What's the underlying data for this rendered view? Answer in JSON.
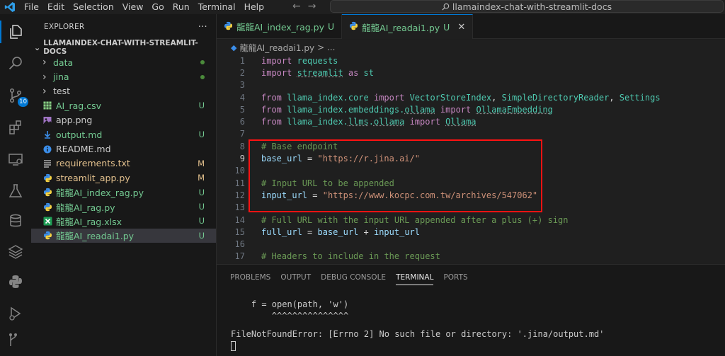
{
  "titlebar": {
    "menu": [
      "File",
      "Edit",
      "Selection",
      "View",
      "Go",
      "Run",
      "Terminal",
      "Help"
    ],
    "search": "llamaindex-chat-with-streamlit-docs"
  },
  "activity": {
    "scm_badge": "10"
  },
  "explorer": {
    "title": "EXPLORER",
    "more": "···",
    "folder": "LLAMAINDEX-CHAT-WITH-STREAMLIT-DOCS",
    "items": [
      {
        "label": "data",
        "kind": "folder",
        "status": "",
        "dot": true,
        "color": "#73c991"
      },
      {
        "label": "jina",
        "kind": "folder",
        "status": "",
        "dot": true,
        "color": "#73c991"
      },
      {
        "label": "test",
        "kind": "folder",
        "status": "",
        "dot": false,
        "color": "#cccccc"
      },
      {
        "label": "AI_rag.csv",
        "kind": "csv",
        "status": "U",
        "dot": false,
        "color": "#73c991"
      },
      {
        "label": "app.png",
        "kind": "image",
        "status": "",
        "dot": false,
        "color": "#cccccc"
      },
      {
        "label": "output.md",
        "kind": "md-download",
        "status": "U",
        "dot": false,
        "color": "#73c991"
      },
      {
        "label": "README.md",
        "kind": "md",
        "status": "",
        "dot": false,
        "color": "#cccccc"
      },
      {
        "label": "requirements.txt",
        "kind": "txt",
        "status": "M",
        "dot": false,
        "color": "#e2c08d"
      },
      {
        "label": "streamlit_app.py",
        "kind": "py",
        "status": "M",
        "dot": false,
        "color": "#e2c08d"
      },
      {
        "label": "龍龍AI_index_rag.py",
        "kind": "py",
        "status": "U",
        "dot": false,
        "color": "#73c991"
      },
      {
        "label": "龍龍AI_rag.py",
        "kind": "py",
        "status": "U",
        "dot": false,
        "color": "#73c991"
      },
      {
        "label": "龍龍AI_rag.xlsx",
        "kind": "xlsx",
        "status": "U",
        "dot": false,
        "color": "#73c991"
      },
      {
        "label": "龍龍AI_readai1.py",
        "kind": "py",
        "status": "U",
        "dot": false,
        "color": "#73c991",
        "selected": true
      }
    ]
  },
  "tabs": [
    {
      "label": "龍龍AI_index_rag.py",
      "status": "U",
      "active": false
    },
    {
      "label": "龍龍AI_readai1.py",
      "status": "U",
      "active": true
    }
  ],
  "breadcrumb": {
    "file": "龍龍AI_readai1.py",
    "rest": "> ..."
  },
  "editor": {
    "current_line": 9,
    "lines": [
      {
        "n": "1",
        "tokens": [
          [
            "kw",
            "import"
          ],
          [
            "op",
            " "
          ],
          [
            "mod",
            "requests"
          ]
        ]
      },
      {
        "n": "2",
        "tokens": [
          [
            "kw",
            "import"
          ],
          [
            "op",
            " "
          ],
          [
            "mod sq",
            "streamlit"
          ],
          [
            "op",
            " "
          ],
          [
            "kw",
            "as"
          ],
          [
            "op",
            " "
          ],
          [
            "mod",
            "st"
          ]
        ]
      },
      {
        "n": "3",
        "tokens": []
      },
      {
        "n": "4",
        "tokens": [
          [
            "kw",
            "from"
          ],
          [
            "op",
            " "
          ],
          [
            "mod",
            "llama_index.core"
          ],
          [
            "op",
            " "
          ],
          [
            "kw",
            "import"
          ],
          [
            "op",
            " "
          ],
          [
            "cl",
            "VectorStoreIndex"
          ],
          [
            "op",
            ", "
          ],
          [
            "cl",
            "SimpleDirectoryReader"
          ],
          [
            "op",
            ", "
          ],
          [
            "cl",
            "Settings"
          ]
        ]
      },
      {
        "n": "5",
        "tokens": [
          [
            "kw",
            "from"
          ],
          [
            "op",
            " "
          ],
          [
            "mod",
            "llama_index.embeddings."
          ],
          [
            "mod sq",
            "ollama"
          ],
          [
            "op",
            " "
          ],
          [
            "kw",
            "import"
          ],
          [
            "op",
            " "
          ],
          [
            "cl sq",
            "OllamaEmbedding"
          ]
        ]
      },
      {
        "n": "6",
        "tokens": [
          [
            "kw",
            "from"
          ],
          [
            "op",
            " "
          ],
          [
            "mod",
            "llama_index."
          ],
          [
            "mod sq",
            "llms"
          ],
          [
            "mod",
            "."
          ],
          [
            "mod sq",
            "ollama"
          ],
          [
            "op",
            " "
          ],
          [
            "kw",
            "import"
          ],
          [
            "op",
            " "
          ],
          [
            "cl sq",
            "Ollama"
          ]
        ]
      },
      {
        "n": "7",
        "tokens": []
      },
      {
        "n": "8",
        "tokens": [
          [
            "cm",
            "# Base endpoint"
          ]
        ]
      },
      {
        "n": "9",
        "tokens": [
          [
            "id",
            "base_url"
          ],
          [
            "op",
            " = "
          ],
          [
            "str",
            "\"https://r.jina.ai/\""
          ]
        ]
      },
      {
        "n": "10",
        "tokens": []
      },
      {
        "n": "11",
        "tokens": [
          [
            "cm",
            "# Input URL to be appended"
          ]
        ]
      },
      {
        "n": "12",
        "tokens": [
          [
            "id",
            "input_url"
          ],
          [
            "op",
            " = "
          ],
          [
            "str",
            "\"https://www.kocpc.com.tw/archives/547062\""
          ]
        ]
      },
      {
        "n": "13",
        "tokens": []
      },
      {
        "n": "14",
        "tokens": [
          [
            "cm",
            "# Full URL with the input URL appended after a plus (+) sign"
          ]
        ]
      },
      {
        "n": "15",
        "tokens": [
          [
            "id",
            "full_url"
          ],
          [
            "op",
            " = "
          ],
          [
            "id",
            "base_url"
          ],
          [
            "op",
            " + "
          ],
          [
            "id",
            "input_url"
          ]
        ]
      },
      {
        "n": "16",
        "tokens": []
      },
      {
        "n": "17",
        "tokens": [
          [
            "cm",
            "# Headers to include in the request"
          ]
        ]
      }
    ]
  },
  "panel": {
    "tabs": [
      "PROBLEMS",
      "OUTPUT",
      "DEBUG CONSOLE",
      "TERMINAL",
      "PORTS"
    ],
    "active_tab": "TERMINAL",
    "terminal_lines": [
      "    f = open(path, 'w')",
      "        ^^^^^^^^^^^^^^^",
      "FileNotFoundError: [Errno 2] No such file or directory: '.jina/output.md'"
    ]
  }
}
